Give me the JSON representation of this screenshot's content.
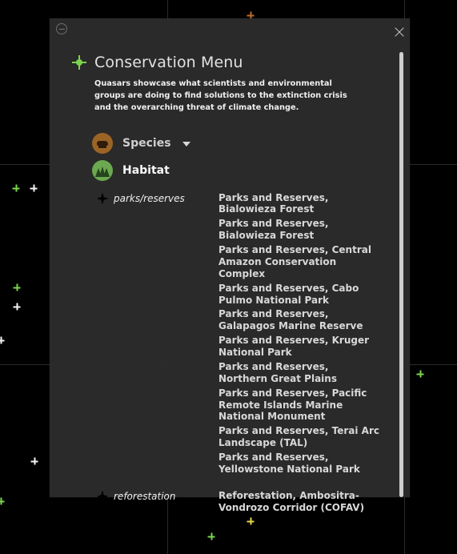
{
  "menu": {
    "title": "Conservation Menu",
    "description": "Quasars showcase what scientists and environmental groups are doing to find solutions to the extinction crisis and the overarching threat of climate change.",
    "nav": [
      {
        "label": "Species",
        "icon": "bear-icon",
        "has_dropdown": true
      },
      {
        "label": "Habitat",
        "icon": "forest-icon"
      }
    ]
  },
  "habitat_groups": [
    {
      "name": "parks/reserves",
      "items": [
        "Parks and Reserves, Bialowieza Forest",
        "Parks and Reserves, Bialowieza Forest",
        "Parks and Reserves, Central Amazon Conservation Complex",
        "Parks and Reserves, Cabo Pulmo National Park",
        "Parks and Reserves, Galapagos Marine Reserve",
        "Parks and Reserves, Kruger National Park",
        "Parks and Reserves, Northern Great Plains",
        "Parks and Reserves, Pacific Remote Islands Marine National Monument",
        "Parks and Reserves, Terai Arc Landscape (TAL)",
        "Parks and Reserves, Yellowstone National Park"
      ]
    },
    {
      "name": "reforestation",
      "items": [
        "Reforestation, Ambositra-Vondrozo Corridor (COFAV)"
      ]
    }
  ],
  "colors": {
    "panel_bg": "#2c2c2c",
    "accent_green": "#7bd44d",
    "species_icon_bg": "#9b6425",
    "habitat_icon_bg": "#6ca84f"
  }
}
